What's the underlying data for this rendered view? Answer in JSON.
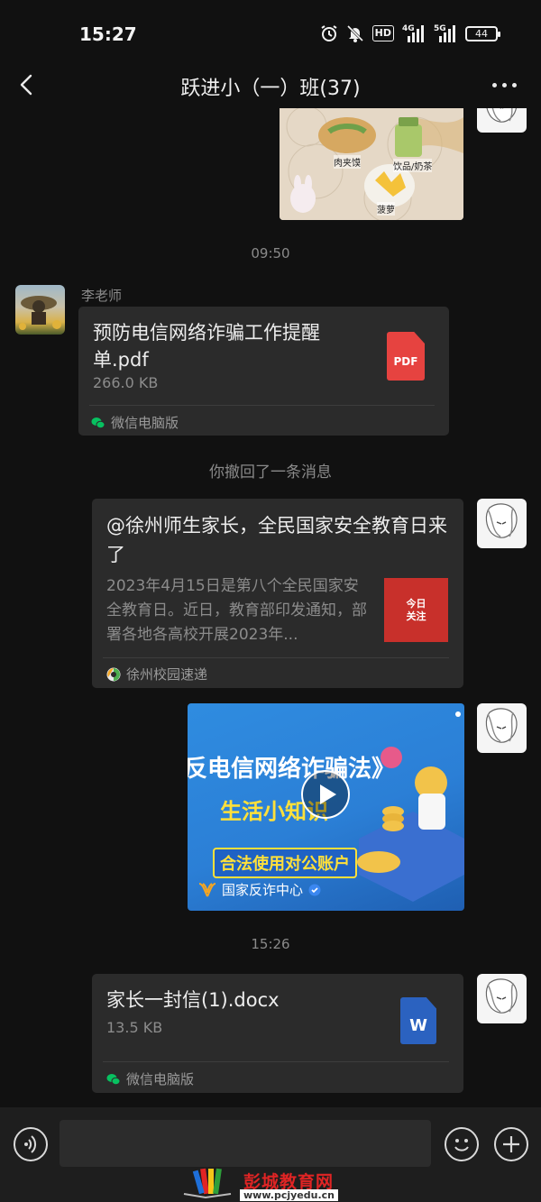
{
  "status_bar": {
    "time": "15:27",
    "icons": [
      "alarm-icon",
      "mute-bell-icon",
      "hd-icon",
      "4g-signal-icon",
      "5g-signal-icon"
    ],
    "hd_label": "HD",
    "net_4g": "4G",
    "net_5g": "5G",
    "battery": "44"
  },
  "header": {
    "title": "跃进小（一）班(37)"
  },
  "messages": {
    "time_1": "09:50",
    "teacher_name": "李老师",
    "file_1": {
      "name": "预防电信网络诈骗工作提醒单.pdf",
      "size": "266.0 KB",
      "icon_label": "PDF",
      "source": "微信电脑版"
    },
    "recall_notice": "你撤回了一条消息",
    "article": {
      "title": "@徐州师生家长，全民国家安全教育日来了",
      "desc": "2023年4月15日是第八个全民国家安全教育日。近日，教育部印发通知，部署各地各高校开展2023年...",
      "thumb_line1": "今日",
      "thumb_line2": "关注",
      "source": "徐州校园速递"
    },
    "video": {
      "line1": "反电信网络诈骗法》",
      "line2": "生活小知识",
      "line3": "合法使用对公账户",
      "channel": "国家反诈中心"
    },
    "image_labels": [
      "肉夹馍",
      "饮品/奶茶",
      "菠萝"
    ],
    "time_2": "15:26",
    "file_2": {
      "name": "家长一封信(1).docx",
      "size": "13.5 KB",
      "icon_label": "W",
      "source": "微信电脑版"
    }
  },
  "input_bar": {
    "placeholder": ""
  },
  "watermark": {
    "title": "彭城教育网",
    "url": "www.pcjyedu.cn"
  },
  "colors": {
    "background": "#111111",
    "bubble": "#2b2b2b",
    "pdf_red": "#e64340",
    "word_blue": "#2b62c0",
    "wechat_green": "#07c160"
  }
}
